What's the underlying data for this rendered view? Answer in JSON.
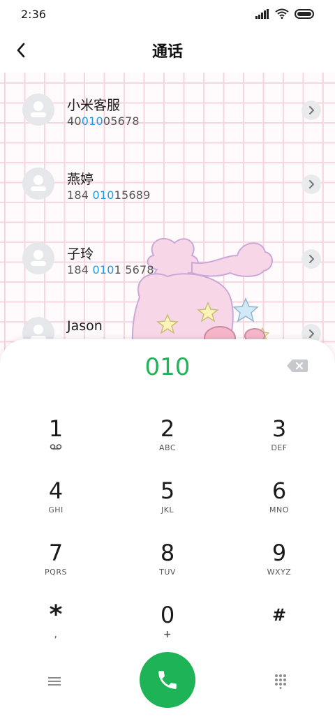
{
  "status_bar": {
    "time": "2:36"
  },
  "header": {
    "title": "通话"
  },
  "contacts": [
    {
      "name": "小米客服",
      "phone_before": "40",
      "phone_match": "010",
      "phone_after": "05678"
    },
    {
      "name": "燕婷",
      "phone_before": "184 ",
      "phone_match": "010",
      "phone_after": "15689"
    },
    {
      "name": "子玲",
      "phone_before": "184 ",
      "phone_match": "010",
      "phone_after": "1 5678"
    },
    {
      "name": "Jason",
      "phone_before": "",
      "phone_match": "",
      "phone_after": ""
    }
  ],
  "dialer": {
    "dialed_number": "010",
    "keys": [
      {
        "digit": "1",
        "letters": ""
      },
      {
        "digit": "2",
        "letters": "ABC"
      },
      {
        "digit": "3",
        "letters": "DEF"
      },
      {
        "digit": "4",
        "letters": "GHI"
      },
      {
        "digit": "5",
        "letters": "JKL"
      },
      {
        "digit": "6",
        "letters": "MNO"
      },
      {
        "digit": "7",
        "letters": "PQRS"
      },
      {
        "digit": "8",
        "letters": "TUV"
      },
      {
        "digit": "9",
        "letters": "WXYZ"
      },
      {
        "digit": "*",
        "letters": ","
      },
      {
        "digit": "0",
        "letters": "+"
      },
      {
        "digit": "#",
        "letters": ""
      }
    ]
  },
  "colors": {
    "accent_green": "#1db356",
    "match_blue": "#1e9be0",
    "grid_pink": "#f6d7df"
  },
  "icons": {
    "back": "chevron-left-icon",
    "contact_arrow": "chevron-right-icon",
    "backspace": "backspace-icon",
    "voicemail": "voicemail-icon",
    "menu": "menu-icon",
    "call": "phone-icon",
    "keypad": "keypad-icon"
  }
}
